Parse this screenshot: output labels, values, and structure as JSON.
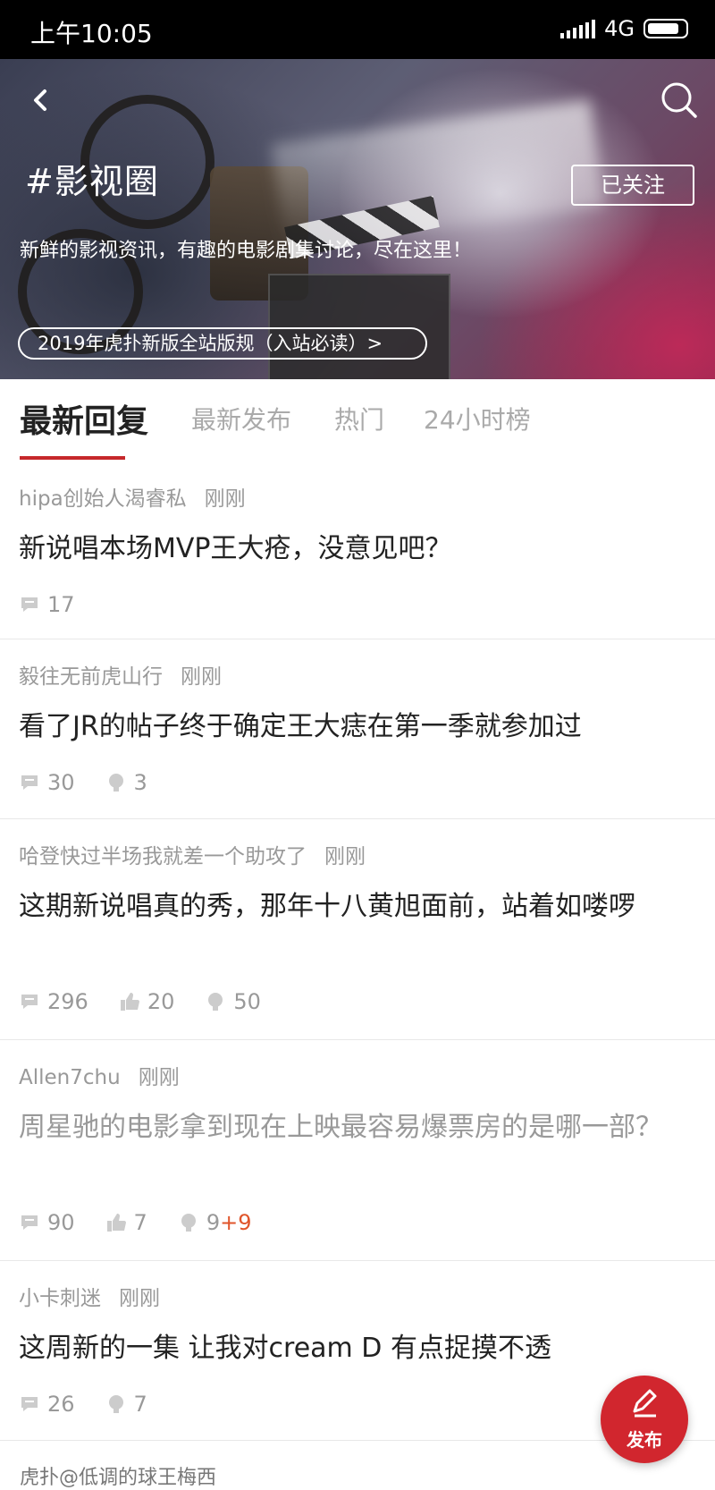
{
  "status_bar": {
    "time": "上午10:05",
    "network": "4G"
  },
  "topic": {
    "title": "#影视圈",
    "follow_label": "已关注",
    "description": "新鲜的影视资讯，有趣的电影剧集讨论，尽在这里！",
    "rules_link": "2019年虎扑新版全站版规（入站必读）>"
  },
  "tabs": [
    {
      "label": "最新回复",
      "active": true
    },
    {
      "label": "最新发布"
    },
    {
      "label": "热门"
    },
    {
      "label": "24小时榜"
    }
  ],
  "posts": [
    {
      "author": "hipa创始人渴睿私",
      "time": "刚刚",
      "title": "新说唱本场MVP王大疮，没意见吧？",
      "read": false,
      "replies": "17"
    },
    {
      "author": "毅往无前虎山行",
      "time": "刚刚",
      "title": "看了JR的帖子终于确定王大痣在第一季就参加过",
      "read": false,
      "replies": "30",
      "lights": "3"
    },
    {
      "author": "哈登快过半场我就差一个助攻了",
      "time": "刚刚",
      "title": "这期新说唱真的秀，那年十八黄旭面前，站着如喽啰",
      "read": false,
      "replies": "296",
      "likes": "20",
      "lights": "50"
    },
    {
      "author": "Allen7chu",
      "time": "刚刚",
      "title": "周星驰的电影拿到现在上映最容易爆票房的是哪一部？",
      "read": true,
      "replies": "90",
      "likes": "7",
      "lights": "9",
      "lights_bonus": "+9"
    },
    {
      "author": "小卡刺迷",
      "time": "刚刚",
      "title": "这周新的一集   让我对cream D 有点捉摸不透",
      "read": false,
      "replies": "26",
      "lights": "7"
    }
  ],
  "fab": {
    "label": "发布"
  },
  "watermark": "虎扑@低调的球王梅西",
  "colors": {
    "accent": "#d1262e",
    "bonus": "#e0552b"
  }
}
